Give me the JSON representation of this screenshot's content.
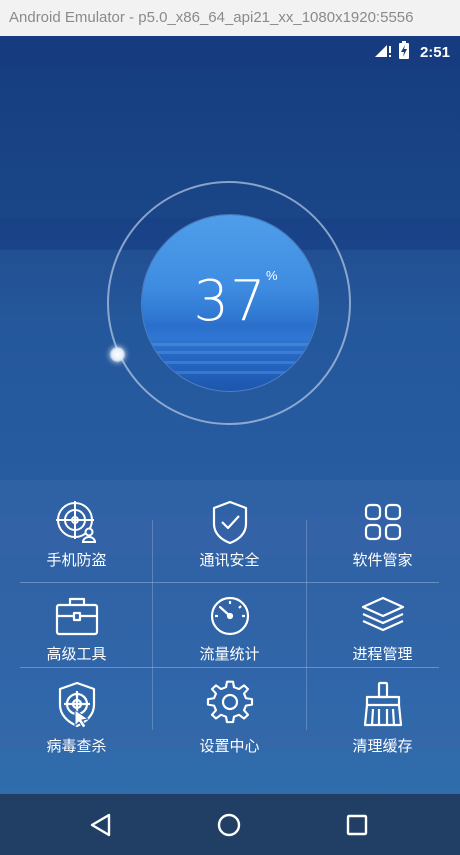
{
  "window": {
    "title": "Android Emulator - p5.0_x86_64_api21_xx_1080x1920:5556"
  },
  "status_bar": {
    "time": "2:51",
    "signal_icon": "signal-no-service-icon",
    "battery_icon": "battery-charging-icon"
  },
  "gauge": {
    "value": "37",
    "unit": "%",
    "level": 0.37
  },
  "tiles": [
    {
      "label": "手机防盗",
      "icon": "phone-antitheft-icon"
    },
    {
      "label": "通讯安全",
      "icon": "shield-check-icon"
    },
    {
      "label": "软件管家",
      "icon": "app-grid-icon"
    },
    {
      "label": "高级工具",
      "icon": "toolbox-icon"
    },
    {
      "label": "流量统计",
      "icon": "speedometer-icon"
    },
    {
      "label": "进程管理",
      "icon": "layers-icon"
    },
    {
      "label": "病毒查杀",
      "icon": "virus-scan-icon"
    },
    {
      "label": "设置中心",
      "icon": "gear-icon"
    },
    {
      "label": "清理缓存",
      "icon": "broom-icon"
    }
  ],
  "nav": {
    "back_icon": "back-triangle-icon",
    "home_icon": "home-circle-icon",
    "recents_icon": "recents-square-icon"
  },
  "colors": {
    "hero_top": "#163e80",
    "hero_bottom": "#275ca0",
    "grid_bg": "#3064a7",
    "nav_bg": "#213f64",
    "gauge_fill": "#3f8de2"
  }
}
